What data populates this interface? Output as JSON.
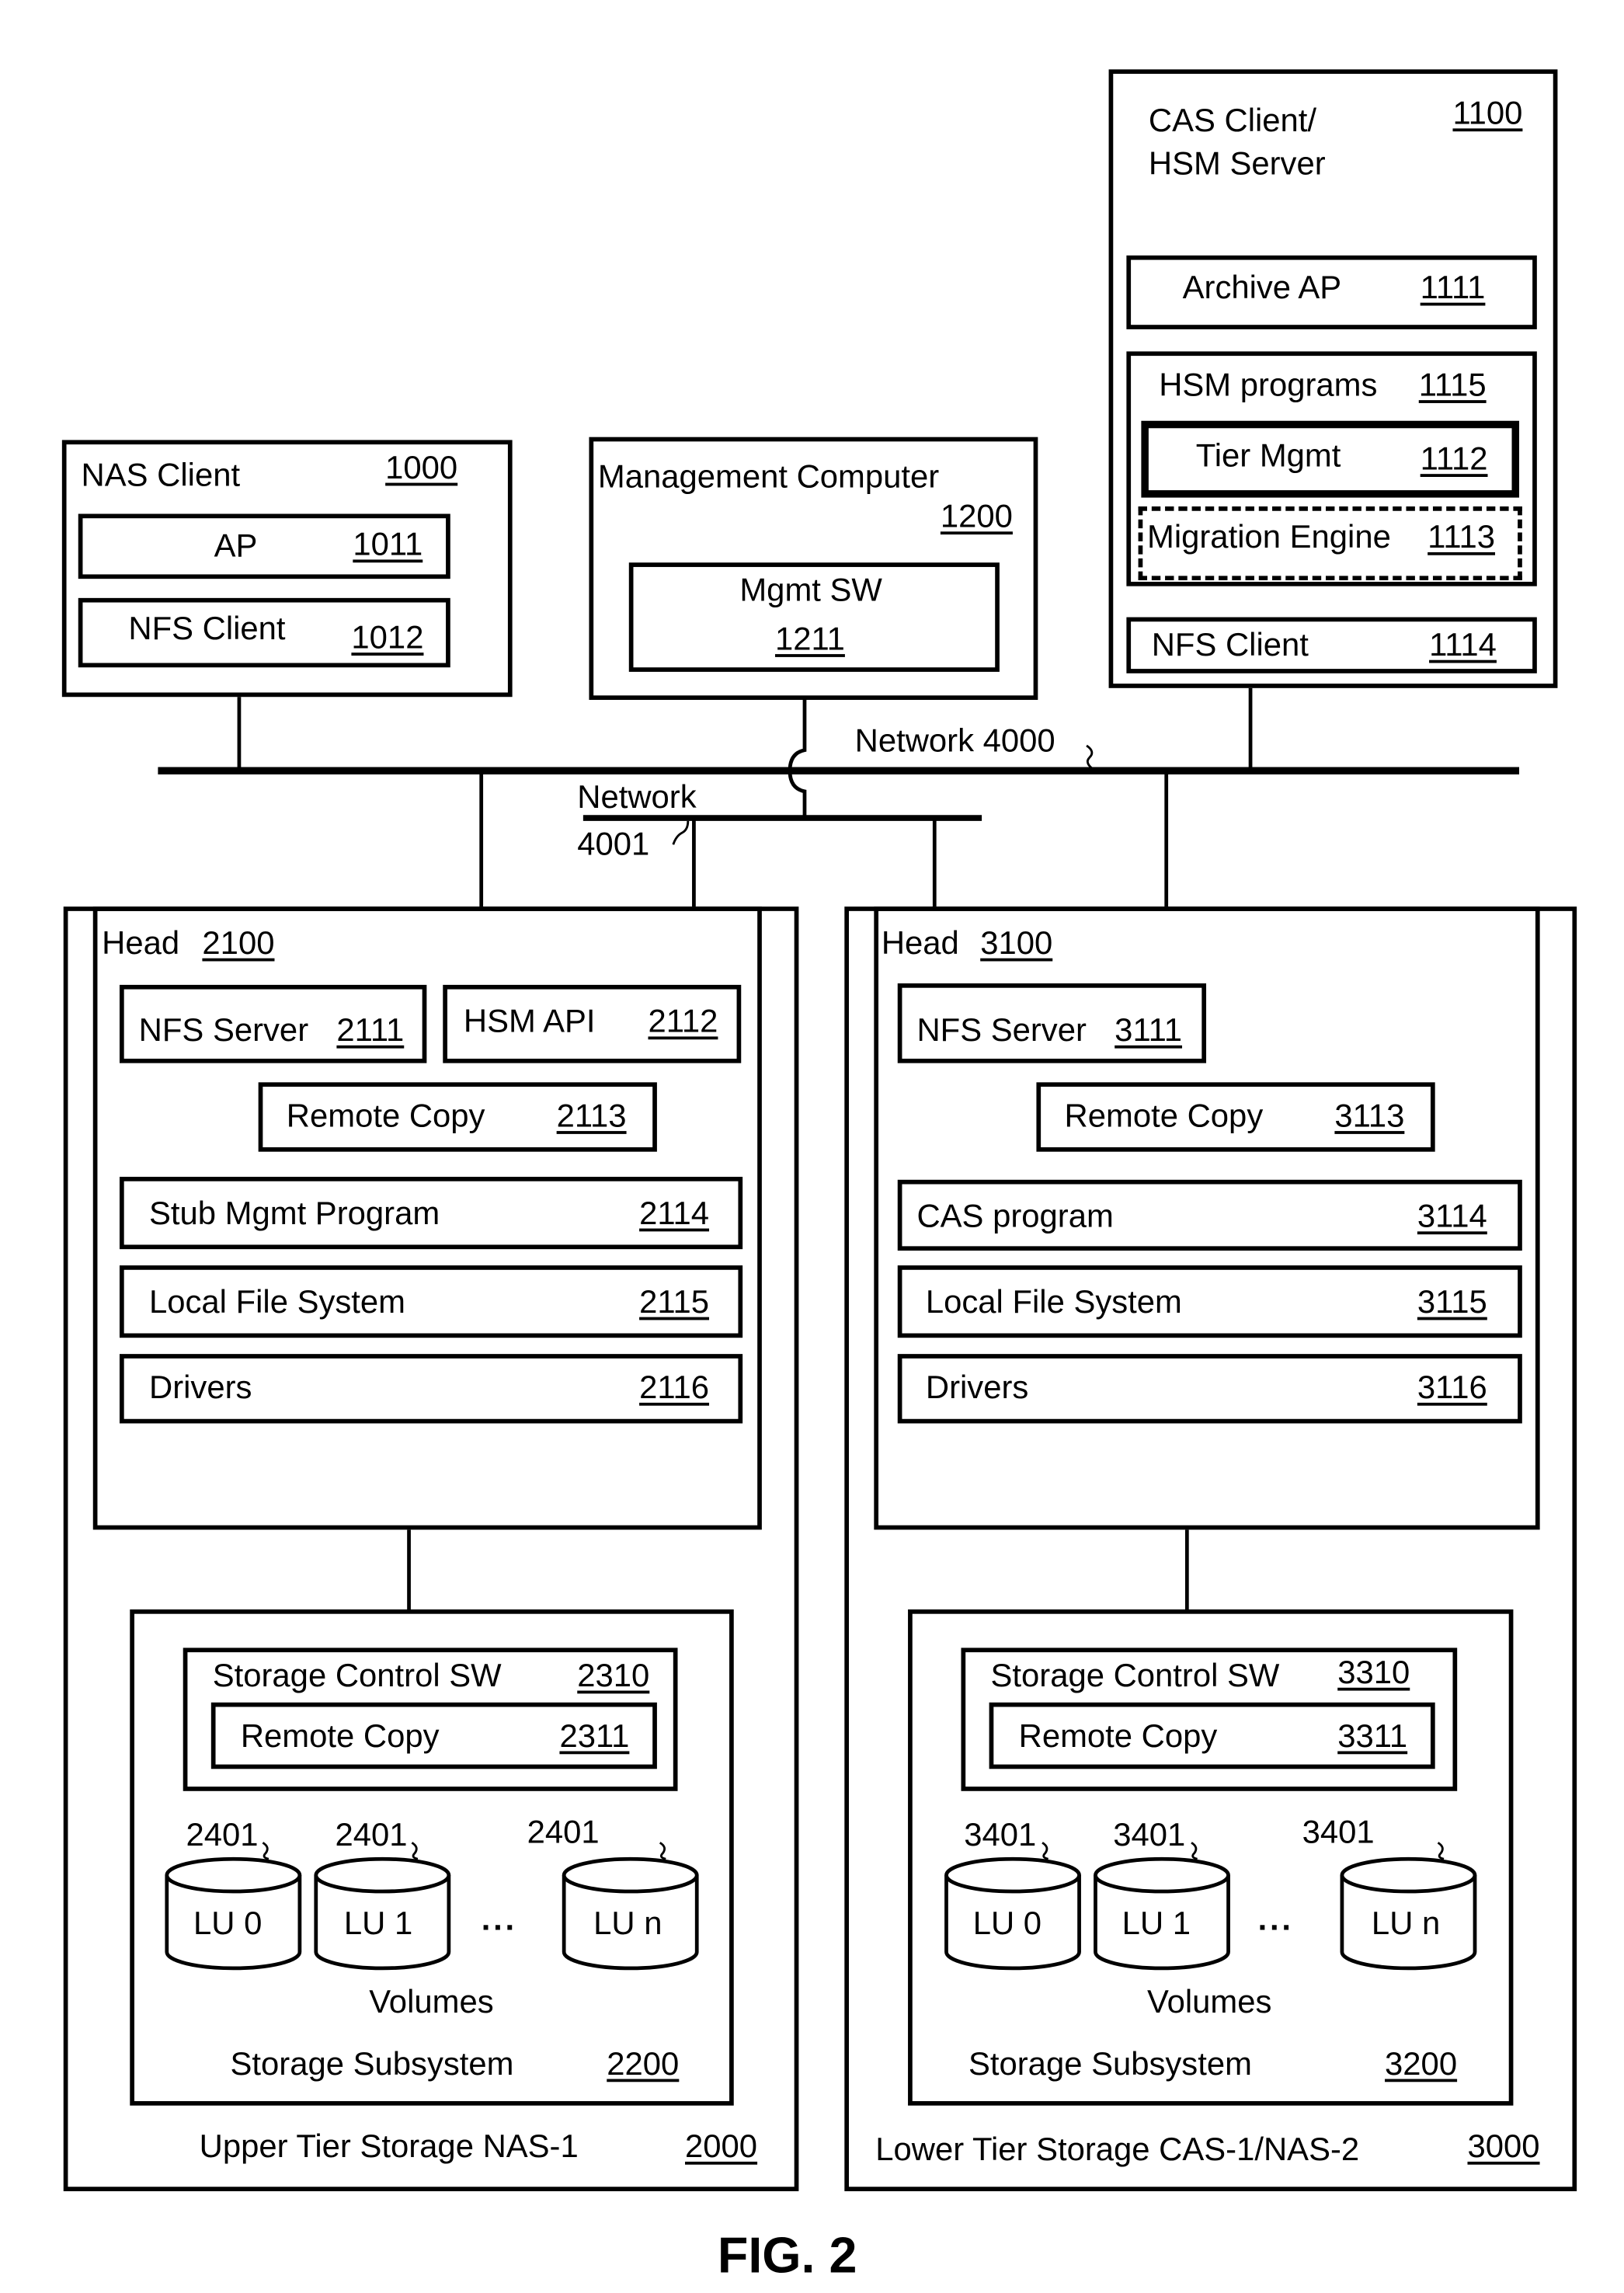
{
  "figure_label": "FIG. 2",
  "nas_client": {
    "title": "NAS Client",
    "ref": "1000",
    "items": [
      {
        "label": "AP",
        "ref": "1011"
      },
      {
        "label": "NFS Client",
        "ref": "1012"
      }
    ]
  },
  "management_computer": {
    "title": "Management Computer",
    "ref": "1200",
    "mgmt_sw": {
      "label": "Mgmt SW",
      "ref": "1211"
    }
  },
  "cas_client": {
    "title_line1": "CAS Client/",
    "title_line2": "HSM Server",
    "ref": "1100",
    "archive_ap": {
      "label": "Archive AP",
      "ref": "1111"
    },
    "hsm_programs": {
      "label": "HSM programs",
      "ref": "1115",
      "tier_mgmt": {
        "label": "Tier Mgmt",
        "ref": "1112"
      },
      "migration_engine": {
        "label": "Migration Engine",
        "ref": "1113"
      }
    },
    "nfs_client": {
      "label": "NFS Client",
      "ref": "1114"
    }
  },
  "network_4000": {
    "label": "Network 4000"
  },
  "network_4001": {
    "label_line1": "Network",
    "label_line2": "4001"
  },
  "upper_tier": {
    "title": "Upper Tier Storage NAS-1",
    "ref": "2000",
    "head": {
      "label": "Head",
      "ref": "2100",
      "nfs_server": {
        "label": "NFS Server",
        "ref": "2111"
      },
      "hsm_api": {
        "label": "HSM API",
        "ref": "2112"
      },
      "remote_copy": {
        "label": "Remote Copy",
        "ref": "2113"
      },
      "stub_mgmt": {
        "label": "Stub Mgmt Program",
        "ref": "2114"
      },
      "local_fs": {
        "label": "Local File System",
        "ref": "2115"
      },
      "drivers": {
        "label": "Drivers",
        "ref": "2116"
      }
    },
    "storage": {
      "label": "Storage Subsystem",
      "ref": "2200",
      "control_sw": {
        "label": "Storage Control SW",
        "ref": "2310"
      },
      "remote_copy": {
        "label": "Remote Copy",
        "ref": "2311"
      },
      "volumes_label": "Volumes",
      "lus": [
        {
          "label": "LU 0",
          "ref": "2401"
        },
        {
          "label": "LU 1",
          "ref": "2401"
        },
        {
          "label": "LU n",
          "ref": "2401"
        }
      ],
      "ellipsis": "..."
    }
  },
  "lower_tier": {
    "title": "Lower Tier Storage CAS-1/NAS-2",
    "ref": "3000",
    "head": {
      "label": "Head",
      "ref": "3100",
      "nfs_server": {
        "label": "NFS Server",
        "ref": "3111"
      },
      "remote_copy": {
        "label": "Remote Copy",
        "ref": "3113"
      },
      "cas_program": {
        "label": "CAS program",
        "ref": "3114"
      },
      "local_fs": {
        "label": "Local File System",
        "ref": "3115"
      },
      "drivers": {
        "label": "Drivers",
        "ref": "3116"
      }
    },
    "storage": {
      "label": "Storage Subsystem",
      "ref": "3200",
      "control_sw": {
        "label": "Storage Control SW",
        "ref": "3310"
      },
      "remote_copy": {
        "label": "Remote Copy",
        "ref": "3311"
      },
      "volumes_label": "Volumes",
      "lus": [
        {
          "label": "LU 0",
          "ref": "3401"
        },
        {
          "label": "LU 1",
          "ref": "3401"
        },
        {
          "label": "LU n",
          "ref": "3401"
        }
      ],
      "ellipsis": "..."
    }
  }
}
